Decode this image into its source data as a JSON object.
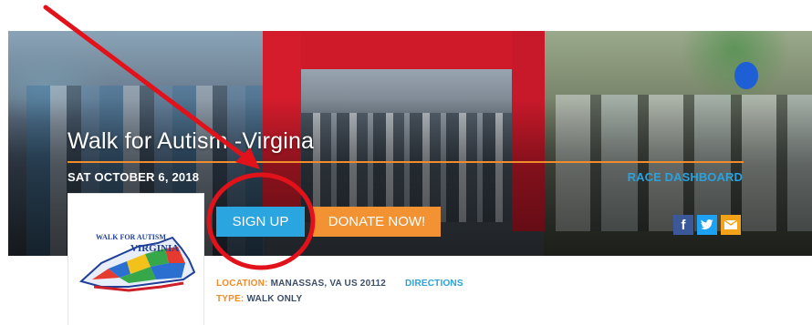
{
  "event": {
    "title": "Walk for Autism -Virgina",
    "date": "SAT OCTOBER 6, 2018",
    "dashboard_link": "RACE DASHBOARD"
  },
  "buttons": {
    "signup": "SIGN UP",
    "donate": "DONATE NOW!"
  },
  "social": [
    "facebook-icon",
    "twitter-icon",
    "email-icon"
  ],
  "logo": {
    "line1": "WALK FOR AUTISM",
    "line2": "VIRGINIA"
  },
  "details": {
    "location_label": "LOCATION:",
    "location_value": "MANASSAS, VA US 20112",
    "directions": "DIRECTIONS",
    "type_label": "TYPE:",
    "type_value": "WALK ONLY"
  },
  "colors": {
    "accent_orange": "#f08c2b",
    "accent_blue": "#2aa5df",
    "annotation_red": "#e2121b"
  }
}
